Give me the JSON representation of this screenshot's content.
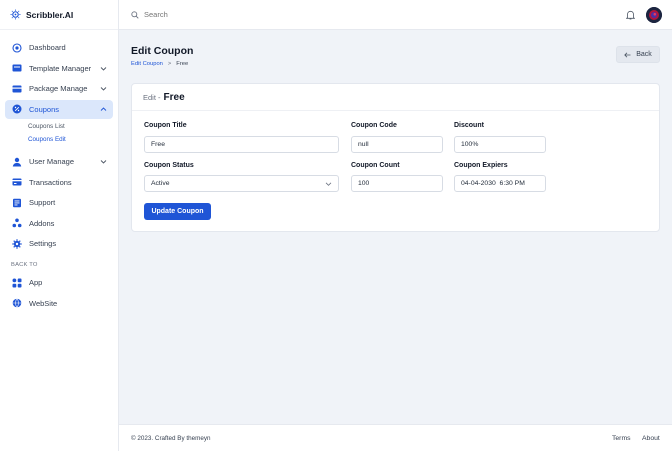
{
  "brand": {
    "name": "Scribbler.AI"
  },
  "search": {
    "placeholder": "Search"
  },
  "sidebar": {
    "items": [
      {
        "label": "Dashboard"
      },
      {
        "label": "Template Manager"
      },
      {
        "label": "Package Manage"
      },
      {
        "label": "Coupons"
      },
      {
        "label": "User Manage"
      },
      {
        "label": "Transactions"
      },
      {
        "label": "Support"
      },
      {
        "label": "Addons"
      },
      {
        "label": "Settings"
      }
    ],
    "coupons_sub": [
      {
        "label": "Coupons List"
      },
      {
        "label": "Coupons Edit"
      }
    ],
    "back_to_label": "BACK TO",
    "back_items": [
      {
        "label": "App"
      },
      {
        "label": "WebSite"
      }
    ]
  },
  "page": {
    "title": "Edit Coupon",
    "breadcrumb": {
      "link": "Edit Coupon",
      "separator": ">",
      "current": "Free"
    },
    "back_label": "Back"
  },
  "form": {
    "header_prefix": "Edit -",
    "header_title": "Free",
    "coupon_title": {
      "label": "Coupon Title",
      "value": "Free"
    },
    "coupon_code": {
      "label": "Coupon Code",
      "value": "null"
    },
    "discount": {
      "label": "Discount",
      "value": "100%"
    },
    "coupon_status": {
      "label": "Coupon Status",
      "value": "Active"
    },
    "coupon_count": {
      "label": "Coupon Count",
      "value": "100"
    },
    "coupon_expiers": {
      "label": "Coupon Expiers",
      "value": "04-04-2030  6:30 PM"
    },
    "submit_label": "Update Coupon"
  },
  "footer": {
    "copyright": "© 2023. Crafted By themeyn",
    "terms": "Terms",
    "about": "About"
  },
  "colors": {
    "accent": "#1f55d6",
    "active_bg": "#dbe7fb",
    "page_bg": "#f0f3f8"
  }
}
